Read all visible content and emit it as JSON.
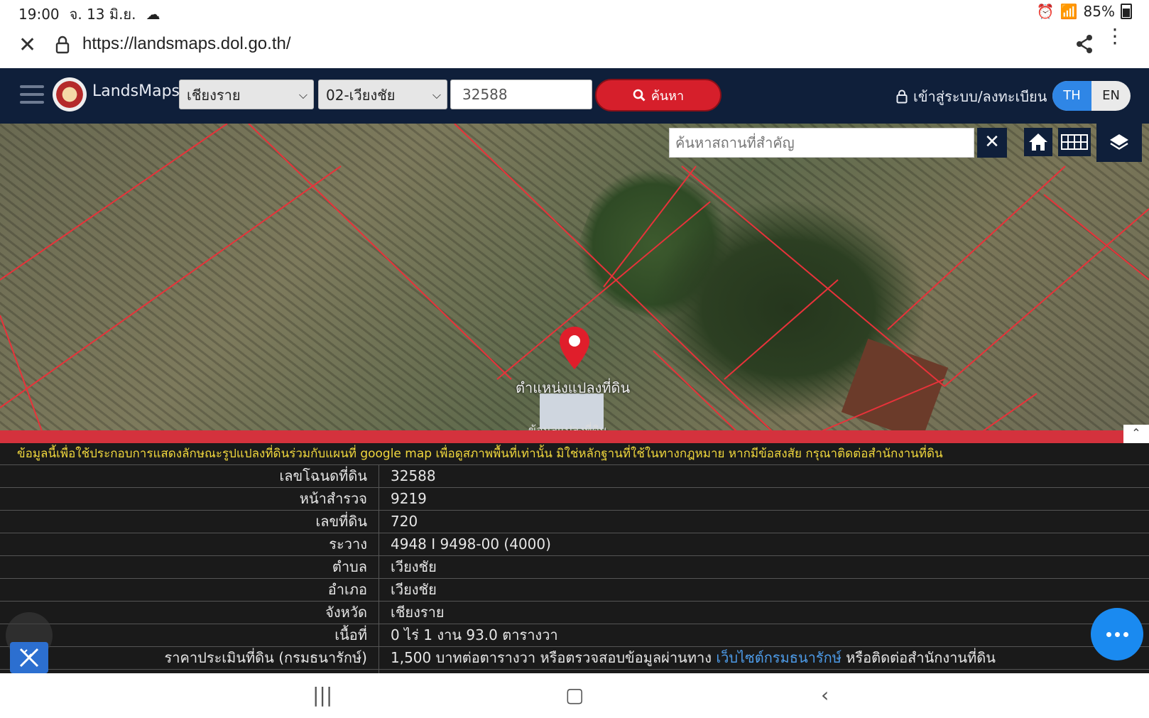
{
  "status": {
    "time": "19:00",
    "date": "จ. 13 มิ.ย.",
    "battery": "85%"
  },
  "browser": {
    "url": "https://landsmaps.dol.go.th/"
  },
  "header": {
    "brand": "LandsMaps",
    "province": "เชียงราย",
    "district": "02-เวียงชัย",
    "parcel_value": "32588",
    "search_label": "ค้นหา",
    "login_label": "เข้าสู่ระบบ/ลงทะเบียน",
    "lang_th": "TH",
    "lang_en": "EN"
  },
  "map": {
    "place_search_placeholder": "ค้นหาสถานที่สำคัญ",
    "pin_label": "ตำแหน่งแปลงที่ดิน",
    "faded_label": "ข้อมูลแปลงที่ดิน",
    "parcel_line_color": "#e8323a"
  },
  "info": {
    "notice": "ข้อมูลนี้เพื่อใช้ประกอบการแสดงลักษณะรูปแปลงที่ดินร่วมกับแผนที่ google map เพื่อดูสภาพพื้นที่เท่านั้น มิใช่หลักฐานที่ใช้ในทางกฎหมาย หากมีข้อสงสัย กรุณาติดต่อสำนักงานที่ดิน",
    "rows": [
      {
        "label": "เลขโฉนดที่ดิน",
        "value": "32588"
      },
      {
        "label": "หน้าสำรวจ",
        "value": "9219"
      },
      {
        "label": "เลขที่ดิน",
        "value": "720"
      },
      {
        "label": "ระวาง",
        "value": "4948 I 9498-00 (4000)"
      },
      {
        "label": "ตำบล",
        "value": "เวียงชัย"
      },
      {
        "label": "อำเภอ",
        "value": "เวียงชัย"
      },
      {
        "label": "จังหวัด",
        "value": "เชียงราย"
      },
      {
        "label": "เนื้อที่",
        "value": "0 ไร่ 1 งาน 93.0 ตารางวา"
      }
    ],
    "price_label": "ราคาประเมินที่ดิน (กรมธนารักษ์)",
    "price_prefix": "1,500 บาทต่อตารางวา หรือตรวจสอบข้อมูลผ่านทาง",
    "price_link": "เว็บไซต์กรมธนารักษ์",
    "price_suffix": "หรือติดต่อสำนักงานที่ดิน"
  }
}
